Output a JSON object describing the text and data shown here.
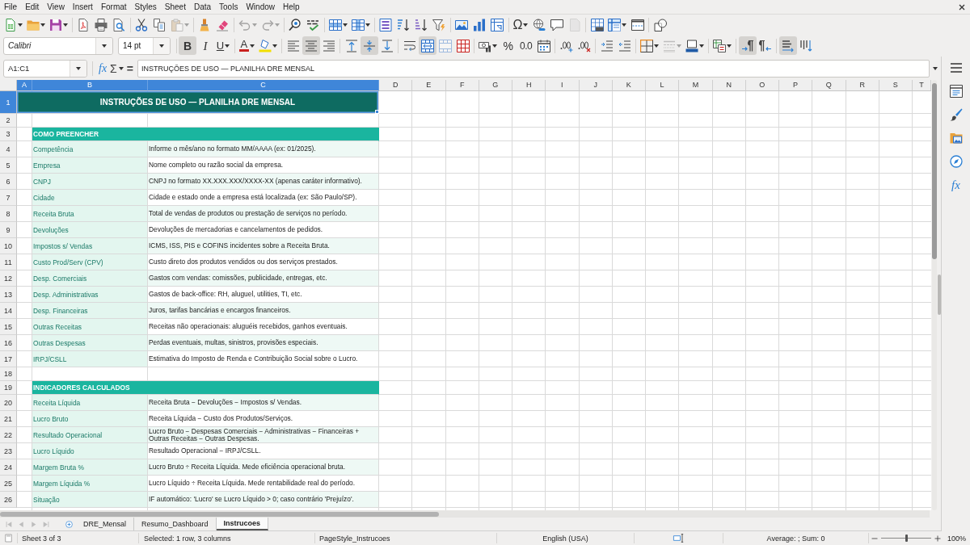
{
  "menu_bar": [
    "File",
    "Edit",
    "View",
    "Insert",
    "Format",
    "Styles",
    "Sheet",
    "Data",
    "Tools",
    "Window",
    "Help"
  ],
  "standard_toolbar": {
    "paste": {
      "disabled": true
    },
    "undo": {
      "disabled": true
    },
    "redo": {
      "disabled": true
    },
    "special_character": {
      "label": "Ω"
    },
    "headers_footers": {
      "disabled": true
    }
  },
  "formatting_toolbar": {
    "font_name": "Calibri",
    "font_size": "14 pt",
    "bold": {
      "label": "B",
      "on": true
    },
    "italic": {
      "label": "I",
      "on": false
    },
    "underline": {
      "label": "U",
      "on": false
    },
    "font_color": {
      "label": "A"
    },
    "align_left": {
      "on": false
    },
    "align_center": {
      "on": true
    },
    "align_right": {
      "on": false
    },
    "align_top": {
      "on": false
    },
    "align_middle": {
      "on": true
    },
    "align_bottom": {
      "on": false
    },
    "wrap_text": {
      "on": false
    },
    "merge_and_center": {
      "on": true
    },
    "merge_cells": {
      "disabled": true
    },
    "percent": {
      "label": "%"
    },
    "number_format": {
      "label": "0.0"
    },
    "border_style": {
      "disabled": true
    },
    "left_to_right": {
      "on": true
    },
    "right_to_left": {
      "on": false
    },
    "text_horizontal": {
      "on": true
    },
    "text_vertical": {
      "on": false
    }
  },
  "formula_bar": {
    "name_box": "A1:C1",
    "function_wizard": "fx",
    "sum": "Σ",
    "formula": "=",
    "content": "INSTRUÇÕES DE USO — PLANILHA DRE MENSAL"
  },
  "sheet": {
    "columns": [
      {
        "label": "A",
        "selected": true
      },
      {
        "label": "B",
        "selected": true
      },
      {
        "label": "C",
        "selected": true
      },
      {
        "label": "D",
        "selected": false
      },
      {
        "label": "E",
        "selected": false
      },
      {
        "label": "F",
        "selected": false
      },
      {
        "label": "G",
        "selected": false
      },
      {
        "label": "H",
        "selected": false
      },
      {
        "label": "I",
        "selected": false
      },
      {
        "label": "J",
        "selected": false
      },
      {
        "label": "K",
        "selected": false
      },
      {
        "label": "L",
        "selected": false
      },
      {
        "label": "M",
        "selected": false
      },
      {
        "label": "N",
        "selected": false
      },
      {
        "label": "O",
        "selected": false
      },
      {
        "label": "P",
        "selected": false
      },
      {
        "label": "Q",
        "selected": false
      },
      {
        "label": "R",
        "selected": false
      },
      {
        "label": "S",
        "selected": false
      },
      {
        "label": "T",
        "selected": false
      }
    ],
    "rows": [
      {
        "number": "1",
        "selected": true,
        "kind": "title",
        "text": "INSTRUÇÕES DE USO — PLANILHA DRE MENSAL"
      },
      {
        "number": "2",
        "selected": false,
        "kind": "blank"
      },
      {
        "number": "3",
        "selected": false,
        "kind": "section",
        "text": "COMO PREENCHER"
      },
      {
        "number": "4",
        "selected": false,
        "kind": "item",
        "label": "Competência",
        "description": "Informe o mês/ano no formato MM/AAAA (ex: 01/2025)."
      },
      {
        "number": "5",
        "selected": false,
        "kind": "item",
        "label": "Empresa",
        "description": "Nome completo ou razão social da empresa."
      },
      {
        "number": "6",
        "selected": false,
        "kind": "item",
        "label": "CNPJ",
        "description": "CNPJ no formato XX.XXX.XXX/XXXX-XX (apenas caráter informativo)."
      },
      {
        "number": "7",
        "selected": false,
        "kind": "item",
        "label": "Cidade",
        "description": "Cidade e estado onde a empresa está localizada (ex: São Paulo/SP)."
      },
      {
        "number": "8",
        "selected": false,
        "kind": "item",
        "label": "Receita Bruta",
        "description": "Total de vendas de produtos ou prestação de serviços no período."
      },
      {
        "number": "9",
        "selected": false,
        "kind": "item",
        "label": "Devoluções",
        "description": "Devoluções de mercadorias e cancelamentos de pedidos."
      },
      {
        "number": "10",
        "selected": false,
        "kind": "item",
        "label": "Impostos s/ Vendas",
        "description": "ICMS, ISS, PIS e COFINS incidentes sobre a Receita Bruta."
      },
      {
        "number": "11",
        "selected": false,
        "kind": "item",
        "label": "Custo Prod/Serv (CPV)",
        "description": "Custo direto dos produtos vendidos ou dos serviços prestados."
      },
      {
        "number": "12",
        "selected": false,
        "kind": "item",
        "label": "Desp. Comerciais",
        "description": "Gastos com vendas: comissões, publicidade, entregas, etc."
      },
      {
        "number": "13",
        "selected": false,
        "kind": "item",
        "label": "Desp. Administrativas",
        "description": "Gastos de back-office: RH, aluguel, utilities, TI, etc."
      },
      {
        "number": "14",
        "selected": false,
        "kind": "item",
        "label": "Desp. Financeiras",
        "description": "Juros, tarifas bancárias e encargos financeiros."
      },
      {
        "number": "15",
        "selected": false,
        "kind": "item",
        "label": "Outras Receitas",
        "description": "Receitas não operacionais: aluguéis recebidos, ganhos eventuais."
      },
      {
        "number": "16",
        "selected": false,
        "kind": "item",
        "label": "Outras Despesas",
        "description": "Perdas eventuais, multas, sinistros, provisões especiais."
      },
      {
        "number": "17",
        "selected": false,
        "kind": "item",
        "label": "IRPJ/CSLL",
        "description": "Estimativa do Imposto de Renda e Contribuição Social sobre o Lucro."
      },
      {
        "number": "18",
        "selected": false,
        "kind": "blank"
      },
      {
        "number": "19",
        "selected": false,
        "kind": "section",
        "text": "INDICADORES CALCULADOS"
      },
      {
        "number": "20",
        "selected": false,
        "kind": "item",
        "label": "Receita Líquida",
        "description": "Receita Bruta − Devoluções − Impostos s/ Vendas."
      },
      {
        "number": "21",
        "selected": false,
        "kind": "item",
        "label": "Lucro Bruto",
        "description": "Receita Líquida − Custo dos Produtos/Serviços."
      },
      {
        "number": "22",
        "selected": false,
        "kind": "item",
        "label": "Resultado Operacional",
        "description": "Lucro Bruto − Despesas Comerciais − Administrativas − Financeiras + Outras Receitas − Outras Despesas."
      },
      {
        "number": "23",
        "selected": false,
        "kind": "item",
        "label": "Lucro Líquido",
        "description": "Resultado Operacional − IRPJ/CSLL."
      },
      {
        "number": "24",
        "selected": false,
        "kind": "item",
        "label": "Margem Bruta %",
        "description": "Lucro Bruto ÷ Receita Líquida. Mede eficiência operacional bruta."
      },
      {
        "number": "25",
        "selected": false,
        "kind": "item",
        "label": "Margem Líquida %",
        "description": "Lucro Líquido ÷ Receita Líquida. Mede rentabilidade real do período."
      },
      {
        "number": "26",
        "selected": false,
        "kind": "item",
        "label": "Situação",
        "description": "IF automático: 'Lucro' se Lucro Líquido > 0; caso contrário 'Prejuízo'."
      }
    ]
  },
  "sheet_navigation": {
    "disabled": true
  },
  "sheet_tabs": [
    {
      "label": "DRE_Mensal",
      "selected": false
    },
    {
      "label": "Resumo_Dashboard",
      "selected": false
    },
    {
      "label": "Instrucoes",
      "selected": true
    }
  ],
  "sidebar": {
    "functions": "fx"
  },
  "status_bar": {
    "sheet": "Sheet 3 of 3",
    "selection": "Selected: 1 row, 3 columns",
    "page_style": "PageStyle_Instrucoes",
    "language": "English (USA)",
    "summary": "Average: ; Sum: 0",
    "zoom": {
      "level": 0.5,
      "reading": "100%"
    }
  }
}
